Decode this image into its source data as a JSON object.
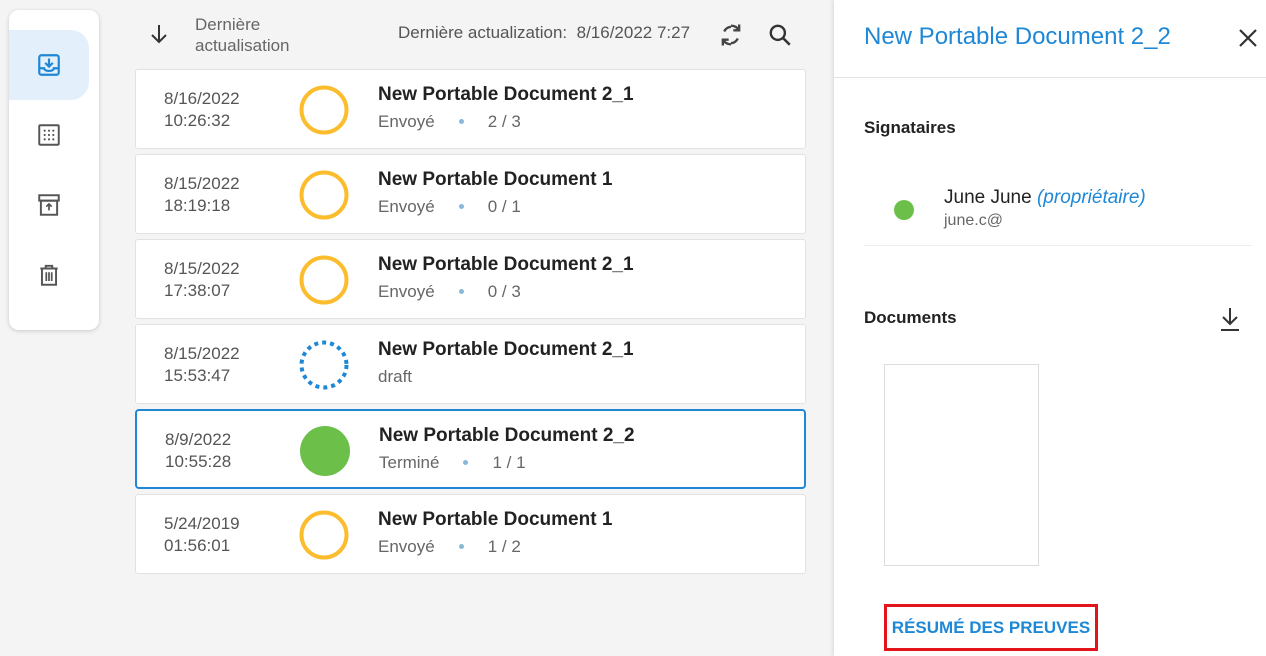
{
  "colors": {
    "accent": "#1e88d6",
    "pending": "#fbbd2d",
    "draft": "#1e88d6",
    "completed": "#6cc04a",
    "highlight": "#e3141b"
  },
  "sidebar": {
    "items": [
      {
        "icon": "inbox-download-icon",
        "active": true
      },
      {
        "icon": "dotted-square-icon",
        "active": false
      },
      {
        "icon": "archive-icon",
        "active": false
      },
      {
        "icon": "trash-icon",
        "active": false
      }
    ]
  },
  "toolbar": {
    "sort_icon": "arrow-down-icon",
    "sort_label_line1": "Dernière",
    "sort_label_line2": "actualisation",
    "last_update_label": "Dernière actualization:",
    "last_update_value": "8/16/2022 7:27",
    "refresh_icon": "refresh-icon",
    "search_icon": "search-icon"
  },
  "documents": [
    {
      "date": "8/16/2022",
      "time": "10:26:32",
      "title": "New Portable Document 2_1",
      "status": "Envoyé",
      "count": "2 / 3",
      "state": "pending"
    },
    {
      "date": "8/15/2022",
      "time": "18:19:18",
      "title": "New Portable Document 1",
      "status": "Envoyé",
      "count": "0 / 1",
      "state": "pending"
    },
    {
      "date": "8/15/2022",
      "time": "17:38:07",
      "title": "New Portable Document 2_1",
      "status": "Envoyé",
      "count": "0 / 3",
      "state": "pending"
    },
    {
      "date": "8/15/2022",
      "time": "15:53:47",
      "title": "New Portable Document 2_1",
      "status": "draft",
      "count": "",
      "state": "draft"
    },
    {
      "date": "8/9/2022",
      "time": "10:55:28",
      "title": "New Portable Document 2_2",
      "status": "Terminé",
      "count": "1 / 1",
      "state": "completed",
      "selected": true
    },
    {
      "date": "5/24/2019",
      "time": "01:56:01",
      "title": "New Portable Document 1",
      "status": "Envoyé",
      "count": "1 / 2",
      "state": "pending"
    }
  ],
  "panel": {
    "title": "New Portable Document 2_2",
    "close_icon": "close-icon",
    "signers_label": "Signataires",
    "signer": {
      "name": "June June",
      "role": "(propriétaire)",
      "email": "june.c@"
    },
    "documents_label": "Documents",
    "download_icon": "download-icon",
    "proof_button": "RÉSUMÉ DES PREUVES"
  }
}
